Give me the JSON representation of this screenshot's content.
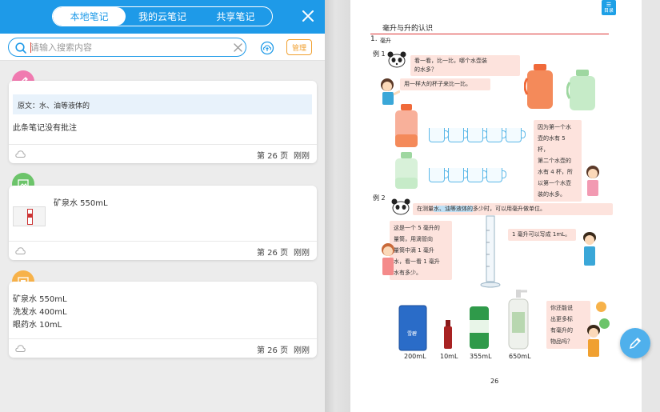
{
  "tabs": [
    {
      "label": "本地笔记",
      "active": true
    },
    {
      "label": "我的云笔记",
      "active": false
    },
    {
      "label": "共享笔记",
      "active": false
    }
  ],
  "search": {
    "placeholder": "请输入搜索内容",
    "value": ""
  },
  "manage_label": "管理",
  "notes": [
    {
      "type": "pen-icon",
      "color": "#f07ab0",
      "quote": "原文：水、油等液体的",
      "text": "此条笔记没有批注",
      "page": "第 26 页",
      "time": "刚刚"
    },
    {
      "type": "picture-icon",
      "color": "#6cc46a",
      "text": "矿泉水 550mL",
      "page": "第 26 页",
      "time": "刚刚"
    },
    {
      "type": "picture-icon",
      "color": "#f7b24a",
      "lines": [
        "矿泉水 550mL",
        "洗发水 400mL",
        "眼药水 10mL"
      ],
      "page": "第 26 页",
      "time": "刚刚"
    }
  ],
  "book": {
    "toc": "目录",
    "title": "毫升与升的认识",
    "section": "1.",
    "section_sub": "毫升",
    "ex1": "例 1",
    "ex1_q": [
      "看一看，比一比，哪个水壶装",
      "的水多？"
    ],
    "ex1_a": "用一样大的杯子来比一比。",
    "ex1_reason": [
      "因为第一个水",
      "壶的水有 5 杯，",
      "第二个水壶的",
      "水有 4 杯，所",
      "以第一个水壶",
      "装的水多。"
    ],
    "ex2": "例 2",
    "ex2_q_pre": "在测量",
    "ex2_q_hl": "水、油等液体的",
    "ex2_q_post": "多少时，可以用毫升做单位。",
    "ex2_desc": [
      "这是一个 5 毫升的",
      "量筒，用滴管向",
      "量筒中滴 1 毫升",
      "水，看一看 1 毫升",
      "水有多少。"
    ],
    "ex2_ml": "1 毫升可以写成 1mL。",
    "products": [
      "200mL",
      "10mL",
      "355mL",
      "650mL"
    ],
    "can_label": "雪碧",
    "question": [
      "你还能说",
      "出更多标",
      "有毫升的",
      "物品吗？"
    ],
    "page_num": "26"
  },
  "colors": {
    "accent": "#1e9ae8",
    "orange": "#f0a030"
  }
}
